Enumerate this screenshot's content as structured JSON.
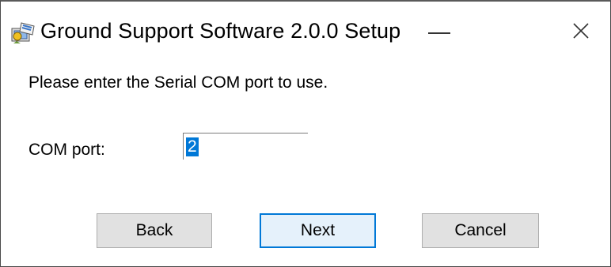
{
  "window": {
    "title": "Ground Support Software 2.0.0 Setup",
    "icon": "installer-icon",
    "controls": {
      "minimize": "minimize-icon",
      "close": "close-icon"
    }
  },
  "content": {
    "prompt": "Please enter the Serial COM port to use.",
    "com_port_label": "COM port:",
    "com_port_value": "2"
  },
  "buttons": {
    "back": "Back",
    "next": "Next",
    "cancel": "Cancel"
  },
  "colors": {
    "selection": "#0078d7",
    "button_face": "#e1e1e1",
    "default_button_border": "#0078d7"
  }
}
